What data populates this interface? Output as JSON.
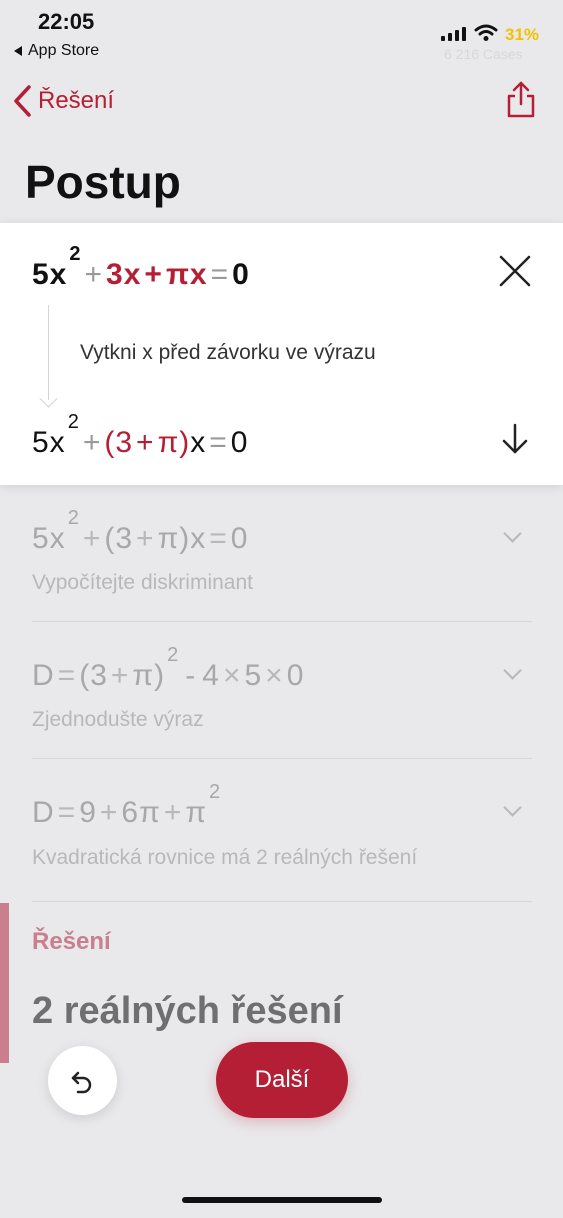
{
  "status_bar": {
    "time": "22:05",
    "back_app": "App Store",
    "battery": "31%",
    "cases": "6 216 Cases"
  },
  "nav": {
    "back_label": "Řešení",
    "title": "Postup"
  },
  "expanded_step": {
    "equation": {
      "a": "5x",
      "exp": "2",
      "plus1": "+",
      "b": "3x",
      "plus2": "+",
      "c": "πx",
      "eq": "=",
      "rhs": "0"
    },
    "description": "Vytkni x před závorku ve výrazu",
    "result": {
      "a": "5x",
      "exp": "2",
      "plus1": "+",
      "lp": "(",
      "three": "3",
      "plus2": "+",
      "pi": "π",
      "rp": ")",
      "x": "x",
      "eq": "=",
      "rhs": "0"
    }
  },
  "steps": [
    {
      "equation": {
        "a": "5x",
        "exp": "2",
        "plus1": "+",
        "lp": "(",
        "three": "3",
        "plus2": "+",
        "pi": "π",
        "rp": ")",
        "x": "x",
        "eq": "=",
        "rhs": "0"
      },
      "note": "Vypočítejte diskriminant"
    },
    {
      "equation": {
        "d": "D",
        "eq": "=",
        "lp": "(",
        "three": "3",
        "plus": "+",
        "pi": "π",
        "rp": ")",
        "exp": "2",
        "minus": "-",
        "four": "4",
        "times1": "×",
        "five": "5",
        "times2": "×",
        "zero": "0"
      },
      "note": "Zjednodušte výraz"
    },
    {
      "equation": {
        "d": "D",
        "eq": "=",
        "nine": "9",
        "plus1": "+",
        "sixpi": "6π",
        "plus2": "+",
        "pi": "π",
        "exp": "2"
      },
      "note": "Kvadratická rovnice má 2 reálných řešení"
    }
  ],
  "solution": {
    "label": "Řešení",
    "value": "2 reálných řešení"
  },
  "buttons": {
    "next": "Další"
  },
  "colors": {
    "accent": "#b51f35",
    "solution_accent": "#c97f8e"
  }
}
